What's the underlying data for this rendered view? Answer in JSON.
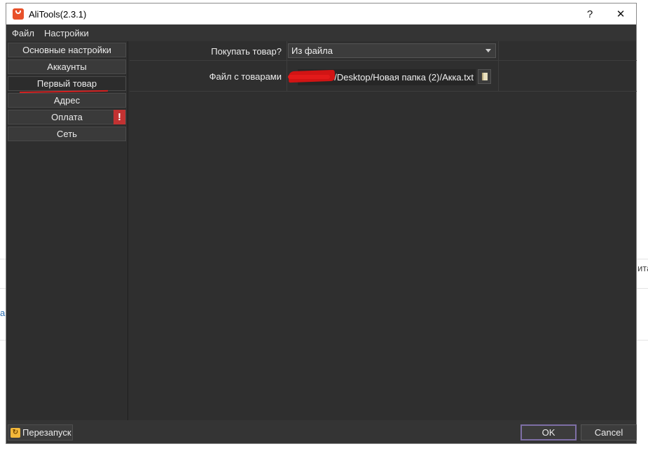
{
  "window": {
    "title": "AliTools(2.3.1)",
    "help_glyph": "?",
    "close_glyph": "✕"
  },
  "menu": [
    "Файл",
    "Настройки"
  ],
  "sidebar": {
    "items": [
      {
        "label": "Основные настройки"
      },
      {
        "label": "Аккаунты"
      },
      {
        "label": "Первый товар"
      },
      {
        "label": "Адрес"
      },
      {
        "label": "Оплата",
        "warning": "!"
      },
      {
        "label": "Сеть"
      }
    ]
  },
  "form": {
    "buy_label": "Покупать товар?",
    "buy_value": "Из файла",
    "file_label": "Файл с товарами",
    "file_path": "/Desktop/Новая папка (2)/Акка.txt"
  },
  "footer": {
    "restart_label": "Перезапуск",
    "ok_label": "OK",
    "cancel_label": "Cancel"
  },
  "background": {
    "left_fragment": "а",
    "right_fragment": "ита"
  },
  "colors": {
    "window_bg": "#343434",
    "panel_bg": "#2f2f2f",
    "warning": "#c23232",
    "annotation_red": "#d42020",
    "default_button_border": "#7e6fa6"
  },
  "icons": {
    "app": "aliexpress-bag-icon",
    "browse": "book-icon",
    "restart": "restart-icon",
    "dropdown": "chevron-down-icon"
  }
}
